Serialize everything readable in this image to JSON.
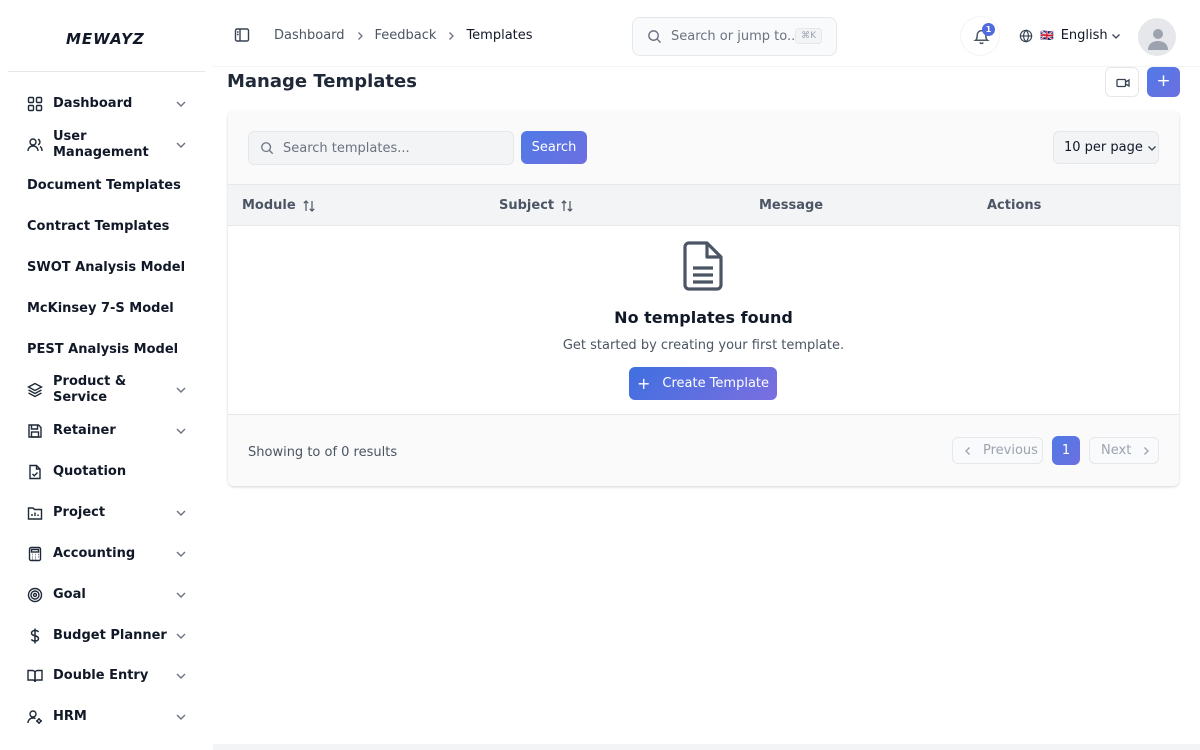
{
  "brand": {
    "logo": "MEWAYZ"
  },
  "sidebar": {
    "items": [
      {
        "label": "Dashboard",
        "icon": "grid-icon",
        "has_children": true
      },
      {
        "label": "User\nManagement",
        "icon": "users-icon",
        "has_children": true
      },
      {
        "label": "Document Templates",
        "icon": "",
        "has_children": false
      },
      {
        "label": "Contract Templates",
        "icon": "",
        "has_children": false
      },
      {
        "label": "SWOT Analysis Model",
        "icon": "",
        "has_children": false
      },
      {
        "label": "McKinsey 7-S Model",
        "icon": "",
        "has_children": false
      },
      {
        "label": "PEST Analysis Model",
        "icon": "",
        "has_children": false
      },
      {
        "label": "Product &\nService",
        "icon": "layers-icon",
        "has_children": true
      },
      {
        "label": "Retainer",
        "icon": "save-icon",
        "has_children": true
      },
      {
        "label": "Quotation",
        "icon": "file-check-icon",
        "has_children": false
      },
      {
        "label": "Project",
        "icon": "folder-chart-icon",
        "has_children": true
      },
      {
        "label": "Accounting",
        "icon": "calculator-icon",
        "has_children": true
      },
      {
        "label": "Goal",
        "icon": "target-icon",
        "has_children": true
      },
      {
        "label": "Budget Planner",
        "icon": "dollar-icon",
        "has_children": true
      },
      {
        "label": "Double Entry",
        "icon": "book-open-icon",
        "has_children": true
      },
      {
        "label": "HRM",
        "icon": "user-cog-icon",
        "has_children": true
      }
    ]
  },
  "header": {
    "breadcrumb": [
      "Dashboard",
      "Feedback",
      "Templates"
    ],
    "search_placeholder": "Search or jump to...",
    "search_shortcut": "⌘K",
    "notification_count": "1",
    "language": "English",
    "language_flag": "🇬🇧"
  },
  "page": {
    "title": "Manage Templates",
    "add_button": "+"
  },
  "templates": {
    "search_placeholder": "Search templates...",
    "search_button": "Search",
    "per_page": "10 per page",
    "columns": [
      "Module",
      "Subject",
      "Message",
      "Actions"
    ],
    "empty_title": "No templates found",
    "empty_subtitle": "Get started by creating your first template.",
    "create_button": "Create Template",
    "create_plus": "+",
    "showing": "Showing to of 0 results",
    "pagination": {
      "previous": "Previous",
      "current": "1",
      "next": "Next"
    }
  },
  "colors": {
    "accent": "#4f7ae6",
    "accent_end": "#6d6fe0"
  }
}
